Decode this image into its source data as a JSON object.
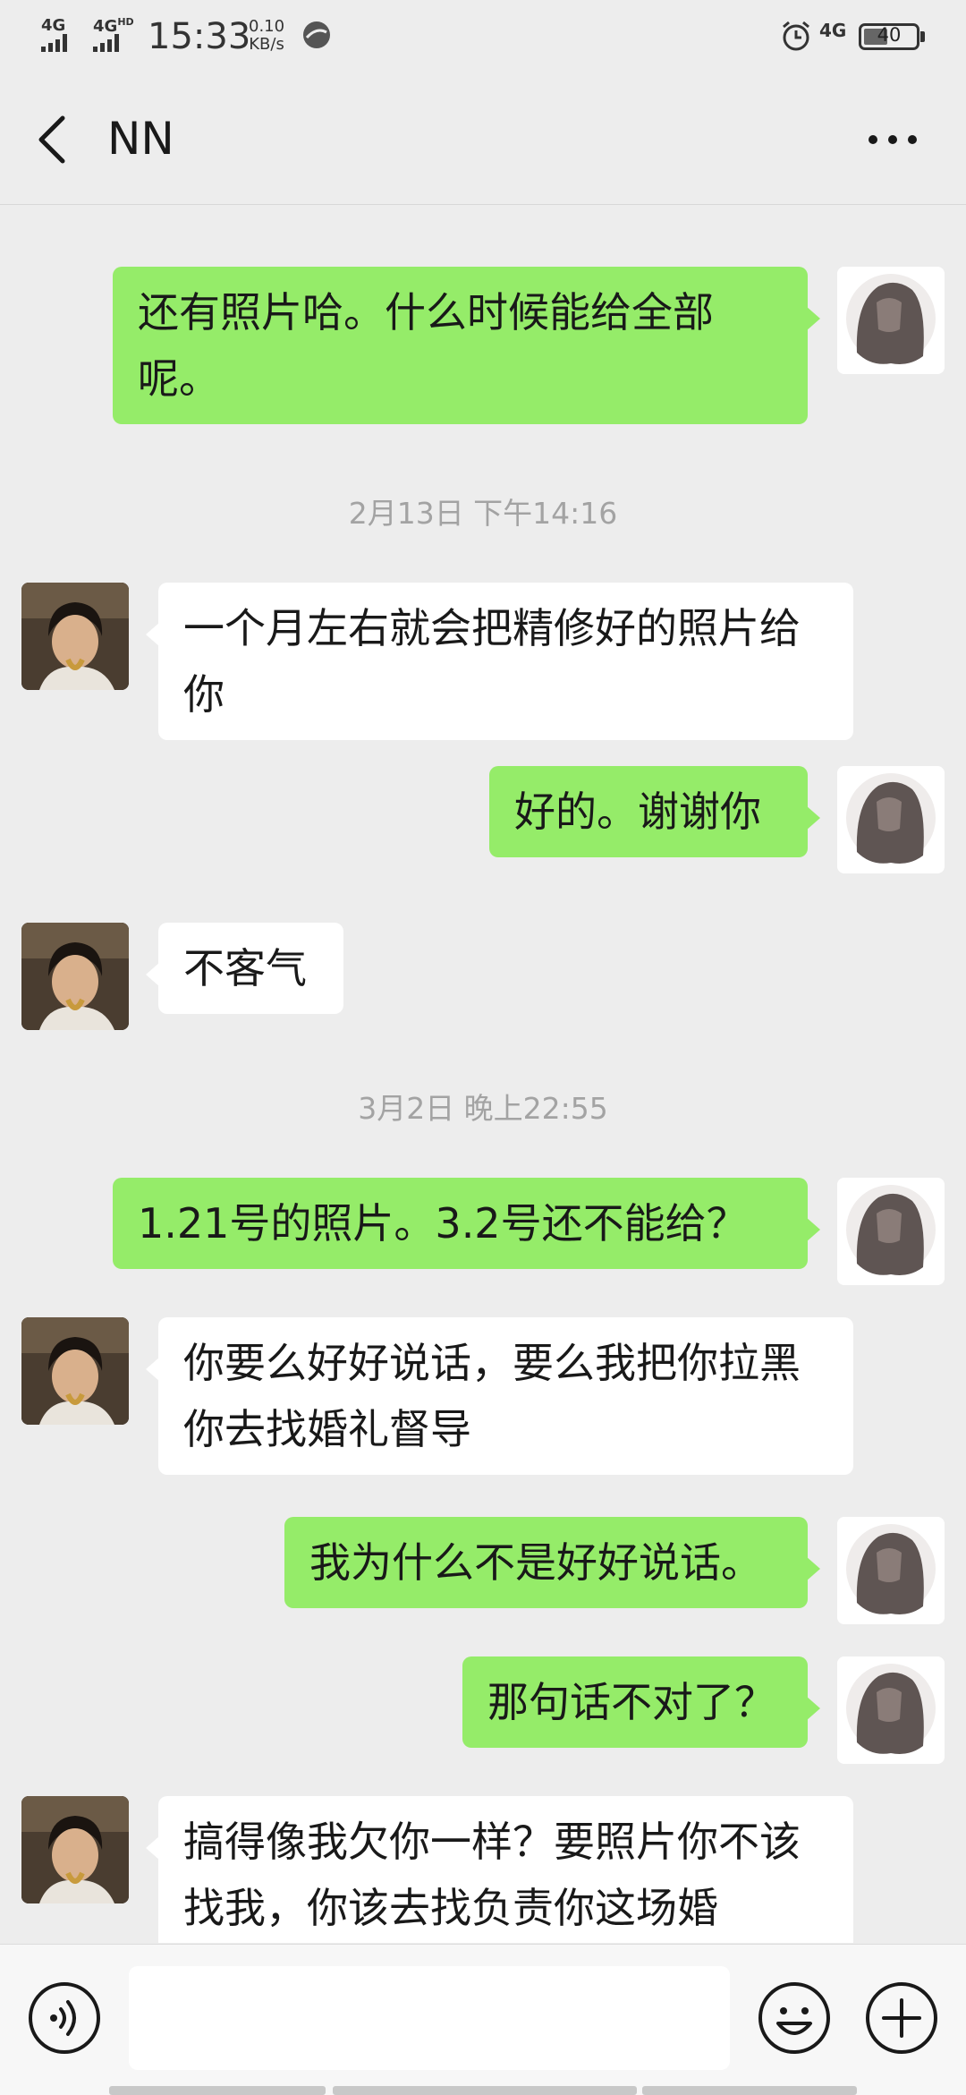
{
  "status_bar": {
    "net1": "4G",
    "net2": "4G",
    "net2_sup": "HD",
    "time": "15:33",
    "speed_value": "0.10",
    "speed_unit": "KB/s",
    "net3": "4G",
    "battery": "40"
  },
  "header": {
    "title": "NN"
  },
  "messages": [
    {
      "from": "me",
      "text": "还有照片哈。什么时候能给全部呢。"
    },
    {
      "timestamp": "2月13日 下午14:16"
    },
    {
      "from": "them",
      "text": "一个月左右就会把精修好的照片给你"
    },
    {
      "from": "me",
      "text": "好的。谢谢你"
    },
    {
      "from": "them",
      "text": "不客气"
    },
    {
      "timestamp": "3月2日 晚上22:55"
    },
    {
      "from": "me",
      "text": "1.21号的照片。3.2号还不能给？"
    },
    {
      "from": "them",
      "text": "你要么好好说话，要么我把你拉黑你去找婚礼督导"
    },
    {
      "from": "me",
      "text": "我为什么不是好好说话。"
    },
    {
      "from": "me",
      "text": "那句话不对了？"
    },
    {
      "from": "them",
      "text": "搞得像我欠你一样？要照片你不该找我，你该去找负责你这场婚"
    }
  ],
  "input": {
    "value": ""
  },
  "colors": {
    "background": "#ededed",
    "self_bubble": "#95ec69",
    "other_bubble": "#ffffff",
    "timestamp_text": "#a3a3a3"
  },
  "icons": {
    "back": "back-chevron-icon",
    "more": "more-dots-icon",
    "voice": "voice-icon",
    "emoji": "emoji-icon",
    "plus": "plus-icon"
  }
}
